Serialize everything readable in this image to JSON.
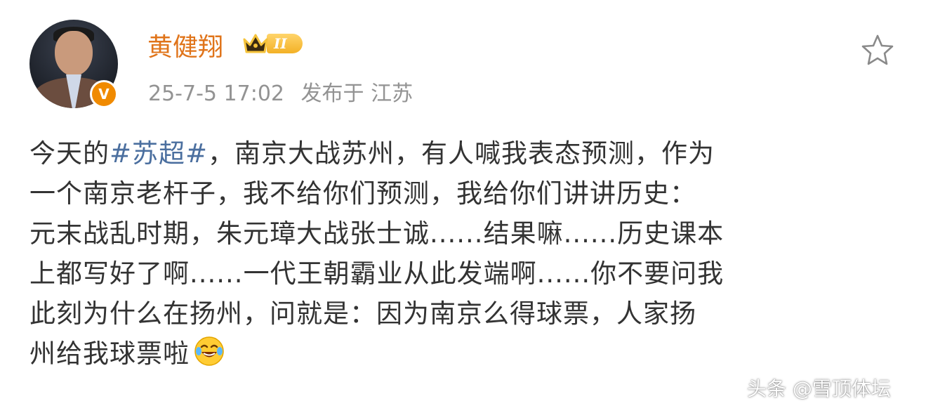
{
  "post": {
    "author": {
      "name": "黄健翔",
      "verified_badge": "V",
      "level_badge": "II"
    },
    "meta": {
      "time": "25-7-5 17:02",
      "location": "发布于 江苏"
    },
    "content": {
      "line1_pre": "今天的",
      "hashtag": "#苏超#",
      "line1_post": "，南京大战苏州，有人喊我表态预测，作为",
      "line2": "一个南京老杆子，我不给你们预测，我给你们讲讲历史：",
      "line3": "元末战乱时期，朱元璋大战张士诚......结果嘛......历史课本",
      "line4": "上都写好了啊......一代王朝霸业从此发端啊......你不要问我",
      "line5": "此刻为什么在扬州，问就是：因为南京么得球票，人家扬",
      "line6": "州给我球票啦",
      "emoji": "laughing-with-tears-emoji"
    }
  },
  "watermark": "头条 @雪顶体坛",
  "colors": {
    "username": "#e0741a",
    "hashtag": "#4b6f9f",
    "meta": "#939393",
    "body_text": "#333333",
    "verified": "#f08a00"
  }
}
